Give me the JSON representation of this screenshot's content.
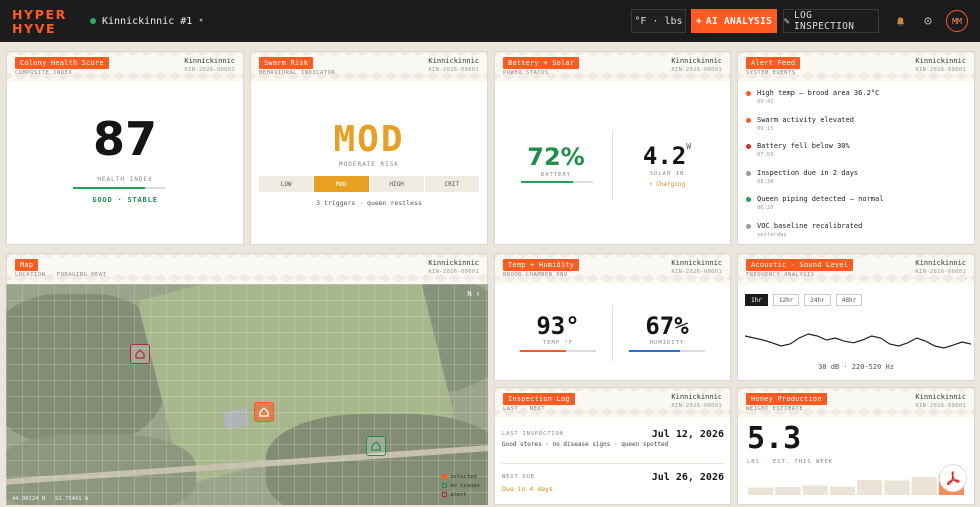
{
  "header": {
    "logo_line1": "HYPER",
    "logo_line2": "HYVE",
    "hive_name": "Kinnickinnic #1",
    "units": "°F · lbs",
    "ai_button": "AI ANALYSIS",
    "log_button": "LOG INSPECTION",
    "avatar": "MM"
  },
  "health": {
    "tag": "Colony Health Score",
    "sub": "COMPOSITE INDEX",
    "hive": "Kinnickinnic",
    "id": "KIN-2026-00001",
    "value": "87",
    "label": "HEALTH INDEX",
    "status": "GOOD · STABLE",
    "progress": 0.78,
    "accent": "#20a45a"
  },
  "swarm": {
    "tag": "Swarm Risk",
    "sub": "BEHAVIORAL INDICATOR",
    "hive": "Kinnickinnic",
    "id": "KIN-2026-00001",
    "value": "MOD",
    "label": "MODERATE RISK",
    "levels": [
      "LOW",
      "MOD",
      "HIGH",
      "CRIT"
    ],
    "active_level": "MOD",
    "note": "3 triggers · queen restless",
    "accent": "#e8a022"
  },
  "battery": {
    "tag": "Battery + Solar",
    "sub": "POWER STATUS",
    "hive": "Kinnickinnic",
    "id": "KIN-2026-00001",
    "battery_value": "72%",
    "battery_label": "BATTERY",
    "battery_level": 0.72,
    "solar_value": "4.2",
    "solar_unit": "W",
    "solar_label": "SOLAR IN",
    "solar_status": "⚡ Charging"
  },
  "alerts": {
    "tag": "Alert Feed",
    "sub": "SYSTEM EVENTS",
    "hive": "Kinnickinnic",
    "id": "KIN-2026-00001",
    "items": [
      {
        "text": "High temp — brood area 36.2°C",
        "time": "09:41",
        "color": "#ff5a1f"
      },
      {
        "text": "Swarm activity elevated",
        "time": "09:15",
        "color": "#ff5a1f"
      },
      {
        "text": "Battery fell below 30%",
        "time": "07:55",
        "color": "#e02424"
      },
      {
        "text": "Inspection due in 2 days",
        "time": "08:30",
        "color": "#999999"
      },
      {
        "text": "Queen piping detected — normal",
        "time": "06:20",
        "color": "#20a45a"
      },
      {
        "text": "VOC baseline recalibrated",
        "time": "yesterday",
        "color": "#999999"
      }
    ]
  },
  "map": {
    "tag": "Map",
    "sub": "LOCATION · FORAGING HEAT",
    "hive": "Kinnickinnic",
    "id": "KIN-2026-00001",
    "north": "N ↑",
    "legend": [
      "selected",
      "no issues",
      "alert"
    ],
    "coords": "44.98124 N · 92.73441 W"
  },
  "temp": {
    "tag": "Temp + Humidity",
    "sub": "BROOD CHAMBER ENV",
    "hive": "Kinnickinnic",
    "id": "KIN-2026-00001",
    "temp_value": "93°",
    "temp_label": "TEMP °F",
    "temp_level": 0.6,
    "hum_value": "67%",
    "hum_label": "HUMIDITY",
    "hum_level": 0.67
  },
  "acoustic": {
    "tag": "Acoustic · Sound Level",
    "sub": "FREQUENCY ANALYSIS",
    "hive": "Kinnickinnic",
    "id": "KIN-2026-00001",
    "ranges": [
      "1hr",
      "12hr",
      "24hr",
      "48hr"
    ],
    "active_range": "1hr",
    "note": "38 dB · 220-520 Hz",
    "wave": [
      0.55,
      0.5,
      0.45,
      0.38,
      0.3,
      0.35,
      0.5,
      0.6,
      0.55,
      0.45,
      0.5,
      0.42,
      0.38,
      0.45,
      0.55,
      0.5,
      0.35,
      0.3,
      0.38,
      0.5,
      0.42,
      0.3,
      0.25,
      0.32,
      0.4,
      0.35
    ]
  },
  "inspection": {
    "tag": "Inspection Log",
    "sub": "LAST · NEXT",
    "hive": "Kinnickinnic",
    "id": "KIN-2026-00001",
    "last_label": "LAST INSPECTION",
    "last_date": "Jul 12, 2026",
    "last_note": "Good stores · no disease signs · queen spotted",
    "next_label": "NEXT DUE",
    "next_date": "Jul 26, 2026",
    "next_note": "Due in 4 days"
  },
  "honey": {
    "tag": "Honey Production",
    "sub": "WEIGHT ESTIMATE",
    "hive": "Kinnickinnic",
    "id": "KIN-2026-00001",
    "value": "5.3",
    "label": "LBS · EST. THIS WEEK",
    "weekly": [
      0.3,
      0.32,
      0.38,
      0.34,
      0.6,
      0.58,
      0.72,
      0.8
    ]
  }
}
